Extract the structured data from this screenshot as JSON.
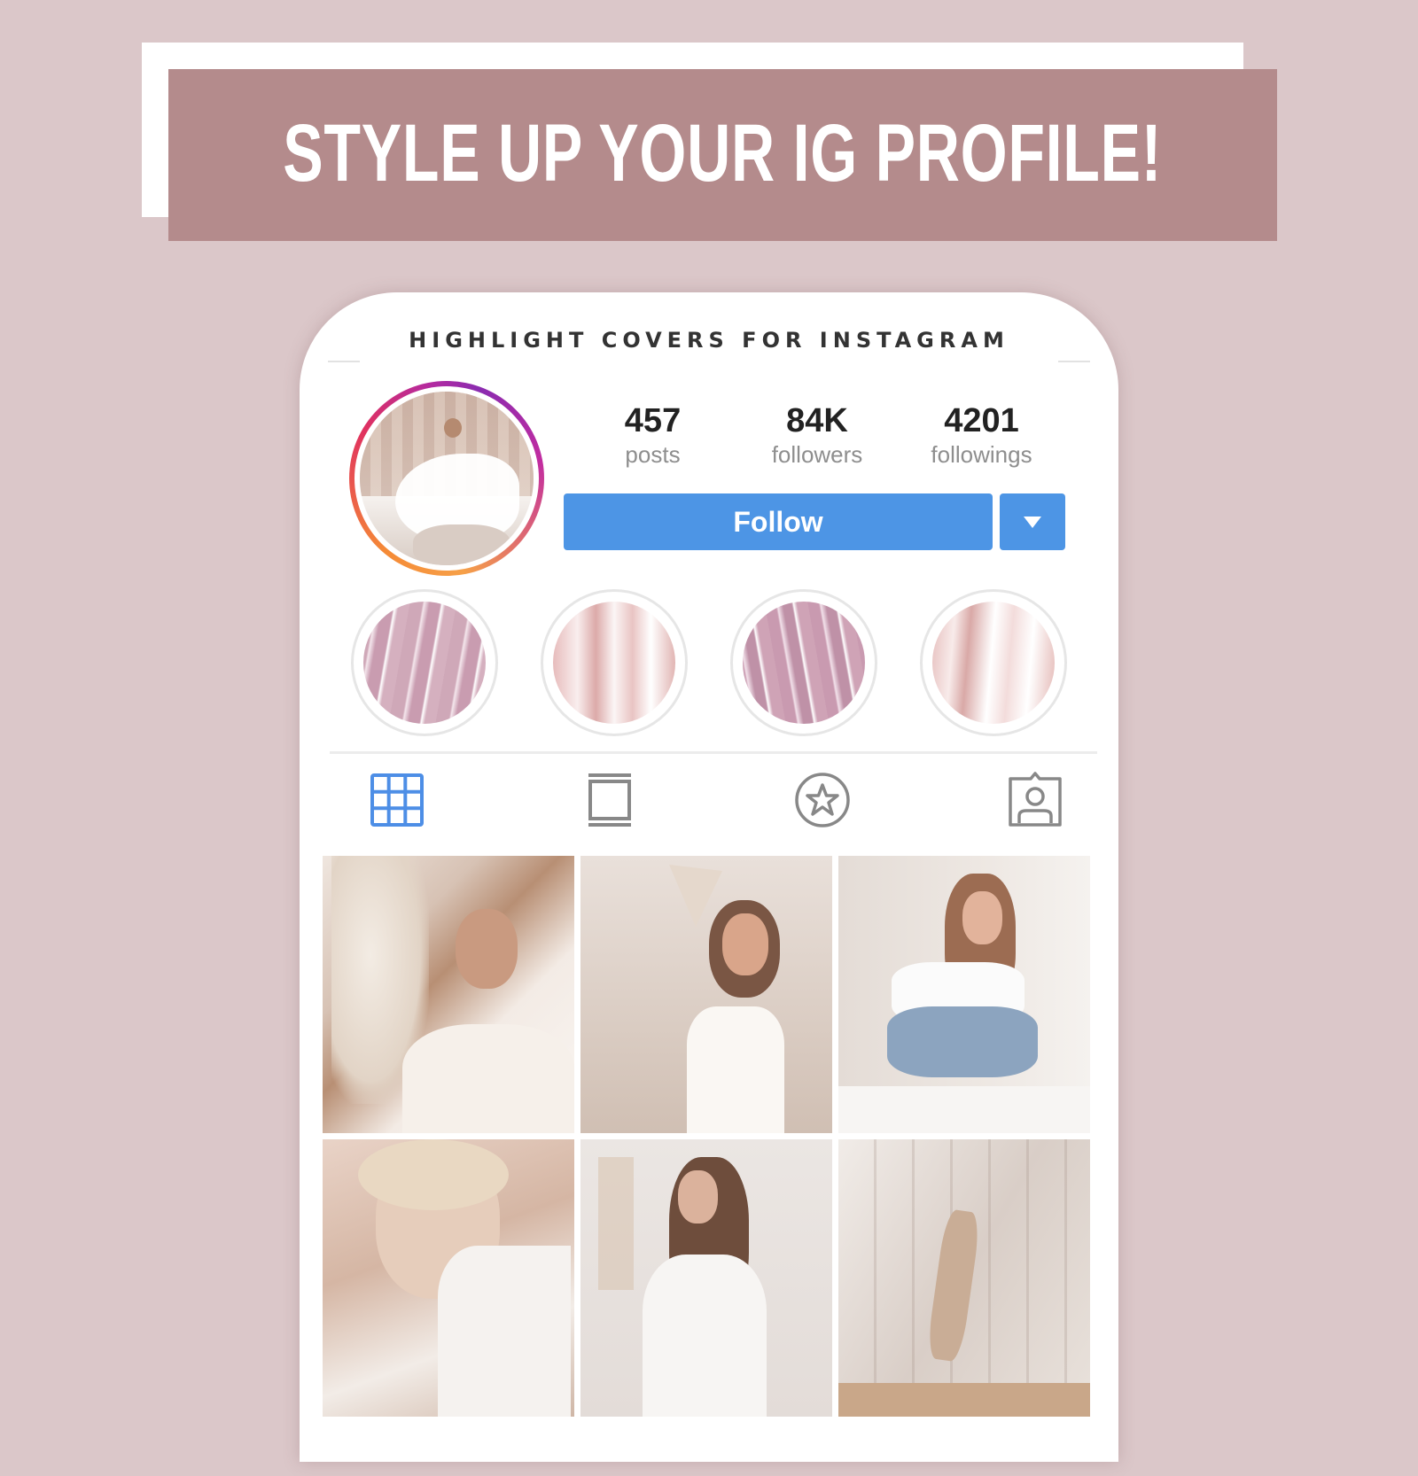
{
  "banner": {
    "title": "STYLE UP YOUR IG PROFILE!",
    "color": "#b48b8c"
  },
  "background_color": "#dbc7c9",
  "phone": {
    "heading": "HIGHLIGHT COVERS FOR INSTAGRAM",
    "profile": {
      "avatar": "bride-in-white-dress-photo",
      "stats": [
        {
          "value": "457",
          "label": "posts"
        },
        {
          "value": "84K",
          "label": "followers"
        },
        {
          "value": "4201",
          "label": "followings"
        }
      ],
      "follow_label": "Follow",
      "dropdown_icon": "caret-down-icon",
      "button_color": "#4d95e5"
    },
    "highlights": [
      {
        "name": "highlight-1",
        "style": "mauve-silk"
      },
      {
        "name": "highlight-2",
        "style": "blush-silk"
      },
      {
        "name": "highlight-3",
        "style": "mauve-silk"
      },
      {
        "name": "highlight-4",
        "style": "blush-silk"
      }
    ],
    "tabs": [
      {
        "icon": "grid-icon",
        "active": true
      },
      {
        "icon": "feed-icon",
        "active": false
      },
      {
        "icon": "star-icon",
        "active": false
      },
      {
        "icon": "tagged-icon",
        "active": false
      }
    ],
    "posts": [
      {
        "desc": "woman-with-pampas-grass"
      },
      {
        "desc": "woman-with-dried-palm-leaf"
      },
      {
        "desc": "woman-sitting-on-windowsill"
      },
      {
        "desc": "blonde-woman-close-up"
      },
      {
        "desc": "woman-in-white-knit-sweater"
      },
      {
        "desc": "dancer-in-beige-jumpsuit"
      }
    ]
  }
}
